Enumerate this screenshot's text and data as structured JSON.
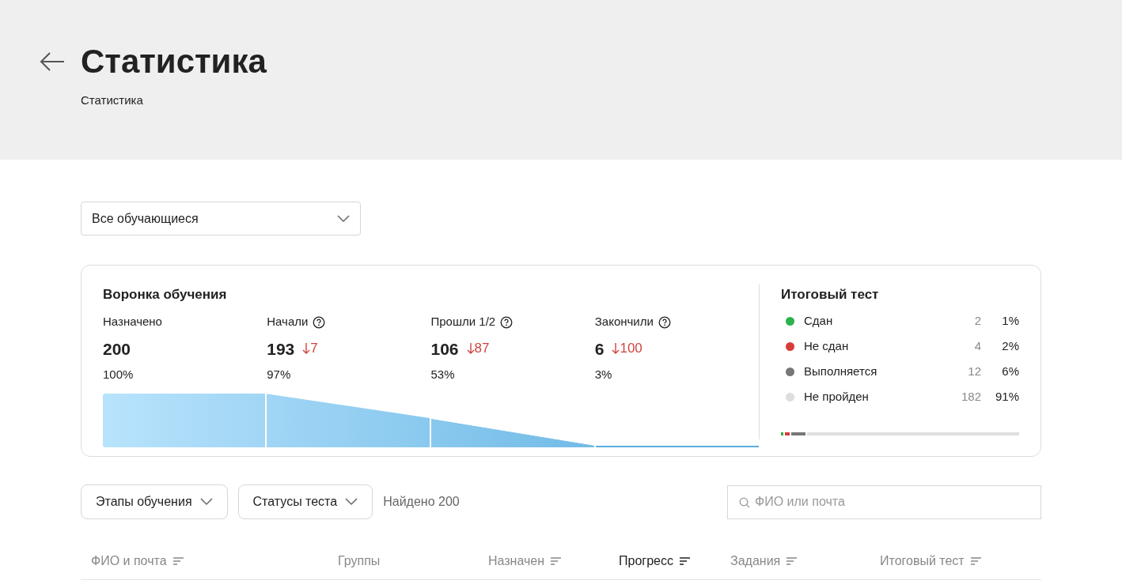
{
  "header": {
    "title": "Статистика",
    "breadcrumb": "Статистика"
  },
  "audience_select": {
    "value": "Все обучающиеся"
  },
  "funnel": {
    "title": "Воронка обучения",
    "stages": [
      {
        "label": "Назначено",
        "help": false,
        "count": "200",
        "percent": "100%"
      },
      {
        "label": "Начали",
        "help": true,
        "count": "193",
        "drop": "7",
        "percent": "97%"
      },
      {
        "label": "Прошли 1/2",
        "help": true,
        "count": "106",
        "drop": "87",
        "percent": "53%"
      },
      {
        "label": "Закончили",
        "help": true,
        "count": "6",
        "drop": "100",
        "percent": "3%"
      }
    ]
  },
  "final_test": {
    "title": "Итоговый тест",
    "items": [
      {
        "label": "Сдан",
        "count": "2",
        "percent": "1%",
        "color": "#2bb24c",
        "level": 0.01
      },
      {
        "label": "Не сдан",
        "count": "4",
        "percent": "2%",
        "color": "#d93b36",
        "level": 0.02
      },
      {
        "label": "Выполняется",
        "count": "12",
        "percent": "6%",
        "color": "#777777",
        "level": 0.06
      },
      {
        "label": "Не пройден",
        "count": "182",
        "percent": "91%",
        "color": "#dedede",
        "level": 0.91
      }
    ]
  },
  "filters": [
    {
      "label": "Этапы обучения"
    },
    {
      "label": "Статусы теста"
    }
  ],
  "found": "Найдено 200",
  "search": {
    "placeholder": "ФИО или почта"
  },
  "table": {
    "columns": [
      {
        "label": "ФИО и почта",
        "sortable": true,
        "selected": false
      },
      {
        "label": "Группы",
        "sortable": false,
        "selected": false
      },
      {
        "label": "Назначен",
        "sortable": true,
        "selected": false
      },
      {
        "label": "Прогресс",
        "sortable": true,
        "selected": true
      },
      {
        "label": "Задания",
        "sortable": true,
        "selected": false
      },
      {
        "label": "Итоговый тест",
        "sortable": true,
        "selected": false
      }
    ]
  }
}
